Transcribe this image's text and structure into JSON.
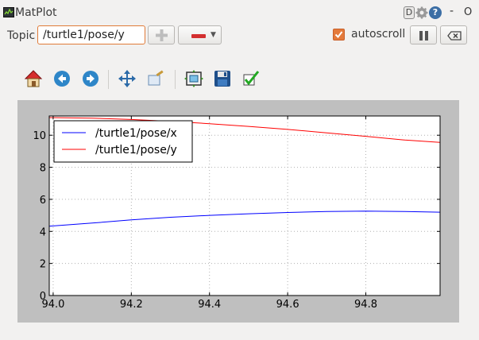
{
  "window": {
    "title": "MatPlot",
    "min_glyph": "-",
    "close_glyph": "O",
    "d_glyph": "D",
    "help_glyph": "?"
  },
  "topbar": {
    "topic_label": "Topic",
    "topic_value": "/turtle1/pose/y",
    "autoscroll_label": "autoscroll",
    "autoscroll_checked": true
  },
  "toolbar": {
    "tools": [
      "home-icon",
      "back-icon",
      "forward-icon",
      "pan-icon",
      "zoom-icon",
      "configure-subplots-icon",
      "save-icon",
      "edit-axes-icon"
    ]
  },
  "chart_data": {
    "type": "line",
    "xlim": [
      93.99,
      94.99
    ],
    "ylim": [
      0,
      11.2
    ],
    "x_ticks": [
      94.0,
      94.2,
      94.4,
      94.6,
      94.8
    ],
    "y_ticks": [
      0,
      2,
      4,
      6,
      8,
      10
    ],
    "x_tick_labels": [
      "94.0",
      "94.2",
      "94.4",
      "94.6",
      "94.8"
    ],
    "y_tick_labels": [
      "0",
      "2",
      "4",
      "6",
      "8",
      "10"
    ],
    "grid": true,
    "legend_position": "upper-left",
    "series": [
      {
        "name": "/turtle1/pose/x",
        "color": "#0000ff",
        "x": [
          93.99,
          94.1,
          94.2,
          94.3,
          94.4,
          94.5,
          94.6,
          94.7,
          94.8,
          94.9,
          94.99
        ],
        "y": [
          4.32,
          4.52,
          4.72,
          4.88,
          5.0,
          5.1,
          5.18,
          5.24,
          5.27,
          5.24,
          5.2
        ]
      },
      {
        "name": "/turtle1/pose/y",
        "color": "#ff0000",
        "x": [
          93.99,
          94.1,
          94.2,
          94.3,
          94.4,
          94.5,
          94.6,
          94.7,
          94.8,
          94.9,
          94.99
        ],
        "y": [
          11.1,
          11.06,
          10.98,
          10.87,
          10.72,
          10.55,
          10.36,
          10.15,
          9.93,
          9.7,
          9.55
        ]
      }
    ]
  }
}
